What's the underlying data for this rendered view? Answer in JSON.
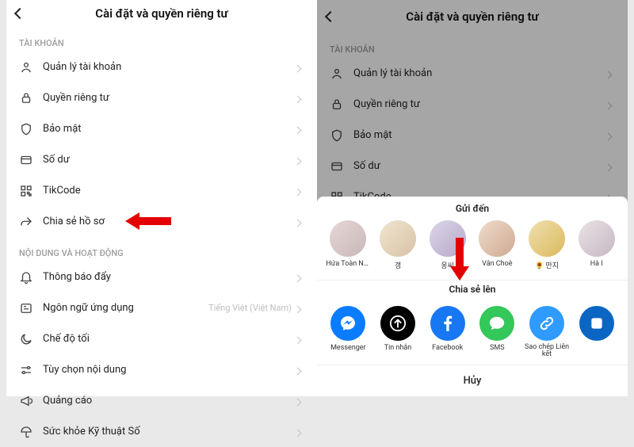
{
  "header": {
    "title": "Cài đặt và quyền riêng tư"
  },
  "sections": {
    "account": {
      "header": "TÀI KHOẢN",
      "items": [
        {
          "label": "Quản lý tài khoản"
        },
        {
          "label": "Quyền riêng tư"
        },
        {
          "label": "Bảo mật"
        },
        {
          "label": "Số dư"
        },
        {
          "label": "TikCode"
        },
        {
          "label": "Chia sẻ hồ sơ"
        }
      ]
    },
    "activity": {
      "header": "NỘI DUNG VÀ HOẠT ĐỘNG",
      "items": [
        {
          "label": "Thông báo đẩy"
        },
        {
          "label": "Ngôn ngữ ứng dụng",
          "trail": "Tiếng Việt (Việt Nam)"
        },
        {
          "label": "Chế độ tối"
        },
        {
          "label": "Tùy chọn nội dung"
        },
        {
          "label": "Quảng cáo"
        },
        {
          "label": "Sức khỏe Kỹ thuật Số"
        }
      ]
    }
  },
  "share": {
    "sendTo": "Gửi đến",
    "shareTo": "Chia sẻ lên",
    "cancel": "Hủy",
    "contacts": [
      {
        "name": "Hứa Toàn Ngọc"
      },
      {
        "name": "갱"
      },
      {
        "name": "웅씨"
      },
      {
        "name": "Vân Choè"
      },
      {
        "name": "🌻 만지"
      },
      {
        "name": "Hà I"
      }
    ],
    "apps": [
      {
        "name": "Messenger",
        "color": "#0a7cff",
        "kind": "messenger"
      },
      {
        "name": "Tin nhắn",
        "color": "#000000",
        "kind": "send"
      },
      {
        "name": "Facebook",
        "color": "#1877f2",
        "kind": "facebook"
      },
      {
        "name": "SMS",
        "color": "#34c759",
        "kind": "sms"
      },
      {
        "name": "Sao chép Liên kết",
        "color": "#2f9bff",
        "kind": "link"
      },
      {
        "name": "",
        "color": "#0a66c2",
        "kind": "more"
      }
    ]
  }
}
